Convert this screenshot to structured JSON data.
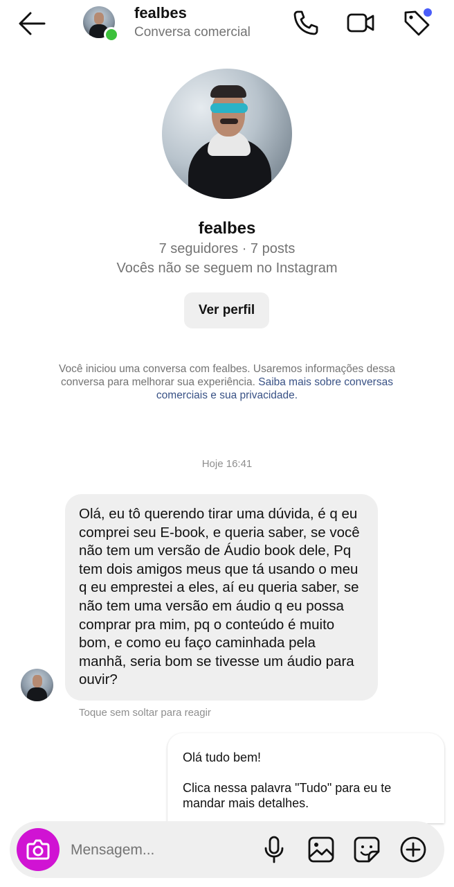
{
  "header": {
    "back_icon": "arrow-left-icon",
    "username": "fealbes",
    "subtitle": "Conversa comercial",
    "actions": [
      "phone-icon",
      "video-camera-icon",
      "tag-icon"
    ],
    "online_color": "#3cc13b",
    "notification_dot_color": "#4a5df9"
  },
  "profile": {
    "name": "fealbes",
    "stats": "7 seguidores · 7 posts",
    "relation": "Vocês não se seguem no Instagram",
    "view_profile_label": "Ver perfil"
  },
  "disclaimer": {
    "text": "Você iniciou uma conversa com fealbes. Usaremos informações dessa conversa para melhorar sua experiência. ",
    "link": "Saiba mais sobre conversas comerciais e sua privacidade.",
    "link_color": "#385185"
  },
  "thread": {
    "timestamp": "Hoje 16:41",
    "incoming_message": "Olá, eu tô querendo tirar uma dúvida, é q eu comprei seu E-book, e queria saber, se você não tem um versão de Áudio book dele, Pq tem dois amigos meus que tá usando o meu q eu emprestei a eles, aí eu queria saber, se não tem uma versão em áudio q eu possa comprar pra mim, pq o conteúdo é muito bom, e como eu faço caminhada pela manhã, seria bom se tivesse um áudio para ouvir?",
    "react_hint": "Toque sem soltar para reagir",
    "outgoing_line1": "Olá tudo bem!",
    "outgoing_line2": "Clica nessa palavra \"Tudo\" para eu te mandar mais detalhes."
  },
  "composer": {
    "placeholder": "Mensagem...",
    "camera_color": "#d013d3",
    "icons": [
      "microphone-icon",
      "image-icon",
      "sticker-icon",
      "plus-circle-icon"
    ]
  }
}
